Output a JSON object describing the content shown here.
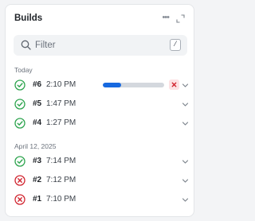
{
  "header": {
    "title": "Builds",
    "more_label": "•••"
  },
  "filter": {
    "placeholder": "Filter",
    "shortcut": "/"
  },
  "groups": [
    {
      "label": "Today",
      "builds": [
        {
          "number": "#6",
          "time": "2:10 PM",
          "status": "running",
          "progress": 0.3
        },
        {
          "number": "#5",
          "time": "1:47 PM",
          "status": "success"
        },
        {
          "number": "#4",
          "time": "1:27 PM",
          "status": "success"
        }
      ]
    },
    {
      "label": "April 12, 2025",
      "builds": [
        {
          "number": "#3",
          "time": "7:14 PM",
          "status": "success"
        },
        {
          "number": "#2",
          "time": "7:12 PM",
          "status": "failed"
        },
        {
          "number": "#1",
          "time": "7:10 PM",
          "status": "failed"
        }
      ]
    }
  ],
  "colors": {
    "success": "#2da44e",
    "failed": "#d1242f",
    "progress": "#1769e0",
    "cancel_bg": "#fde2e4"
  },
  "icons": {
    "success": "check-circle-icon",
    "failed": "x-circle-icon",
    "expand": "expand-icon",
    "search": "search-icon",
    "chevron": "chevron-down-icon",
    "cancel": "cancel-icon"
  }
}
